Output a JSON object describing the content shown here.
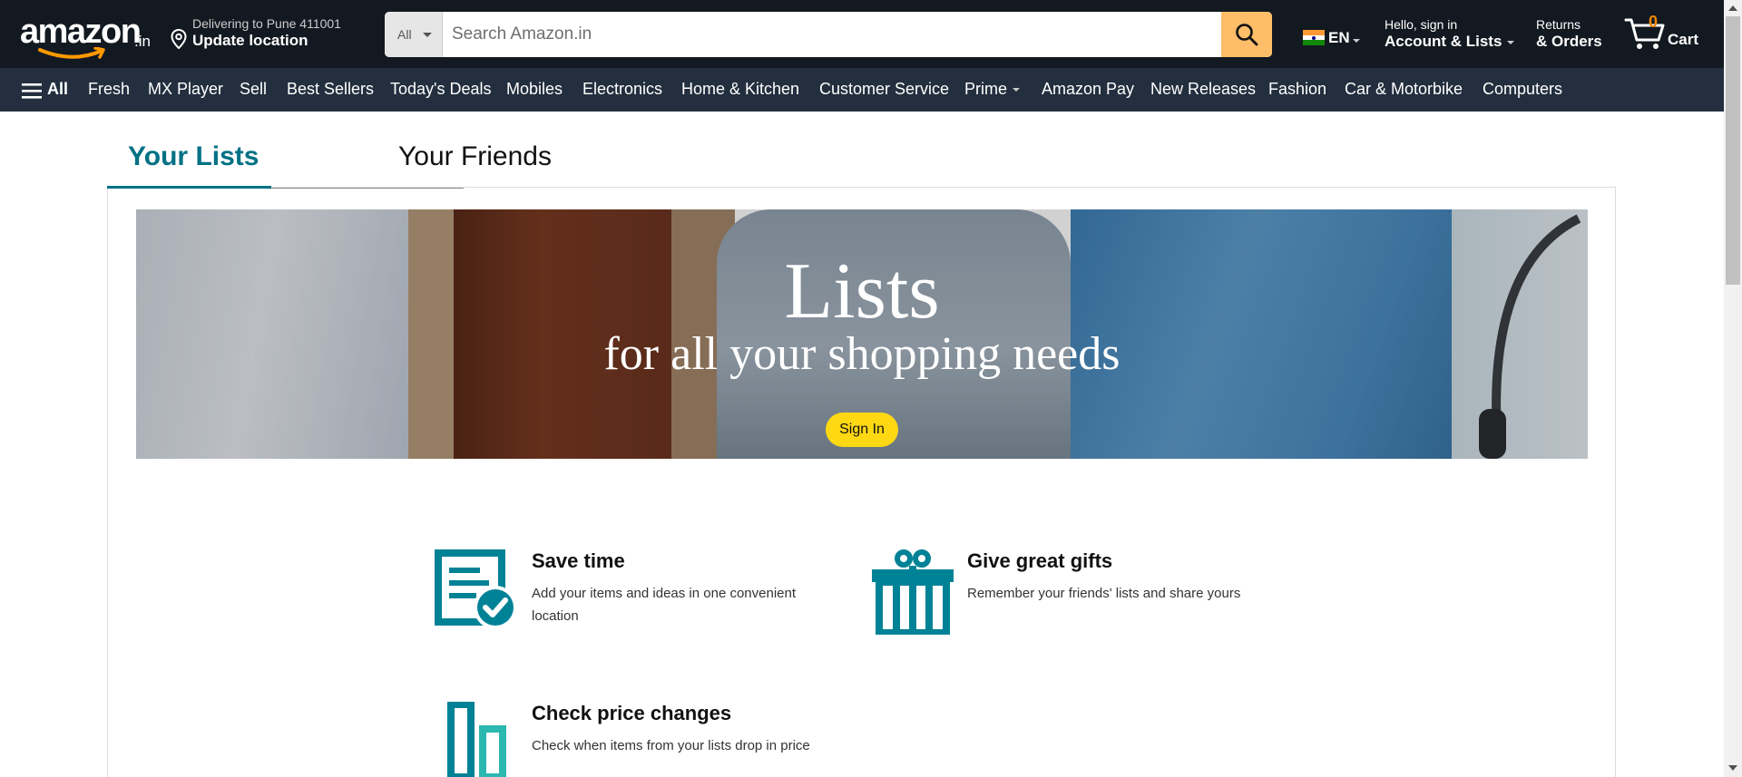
{
  "header": {
    "logo_text": "amazon",
    "logo_tld": ".in",
    "deliver_line1": "Delivering to Pune 411001",
    "deliver_line2": "Update location",
    "search_category": "All",
    "search_placeholder": "Search Amazon.in",
    "language": "EN",
    "account_line1": "Hello, sign in",
    "account_line2": "Account & Lists",
    "returns_line1": "Returns",
    "returns_line2": "& Orders",
    "cart_count": "0",
    "cart_label": "Cart"
  },
  "nav": {
    "all_label": "All",
    "items": [
      "Fresh",
      "MX Player",
      "Sell",
      "Best Sellers",
      "Today's Deals",
      "Mobiles",
      "Electronics",
      "Home & Kitchen",
      "Customer Service",
      "Prime",
      "Amazon Pay",
      "New Releases",
      "Fashion",
      "Car & Motorbike",
      "Computers"
    ]
  },
  "tabs": {
    "lists": "Your Lists",
    "friends": "Your Friends"
  },
  "hero": {
    "title": "Lists",
    "subtitle": "for all your shopping needs",
    "button": "Sign In"
  },
  "features": [
    {
      "title": "Save time",
      "desc": "Add your items and ideas in one convenient location"
    },
    {
      "title": "Give great gifts",
      "desc": "Remember your friends' lists and share yours"
    },
    {
      "title": "Check price changes",
      "desc": "Check when items from your lists drop in price"
    }
  ],
  "colors": {
    "nav_dark": "#131921",
    "nav_secondary": "#232f3e",
    "accent_teal": "#007185",
    "icon_teal": "#008296",
    "search_button": "#febd69",
    "signin_button": "#ffd814",
    "cart_count": "#f08804"
  }
}
